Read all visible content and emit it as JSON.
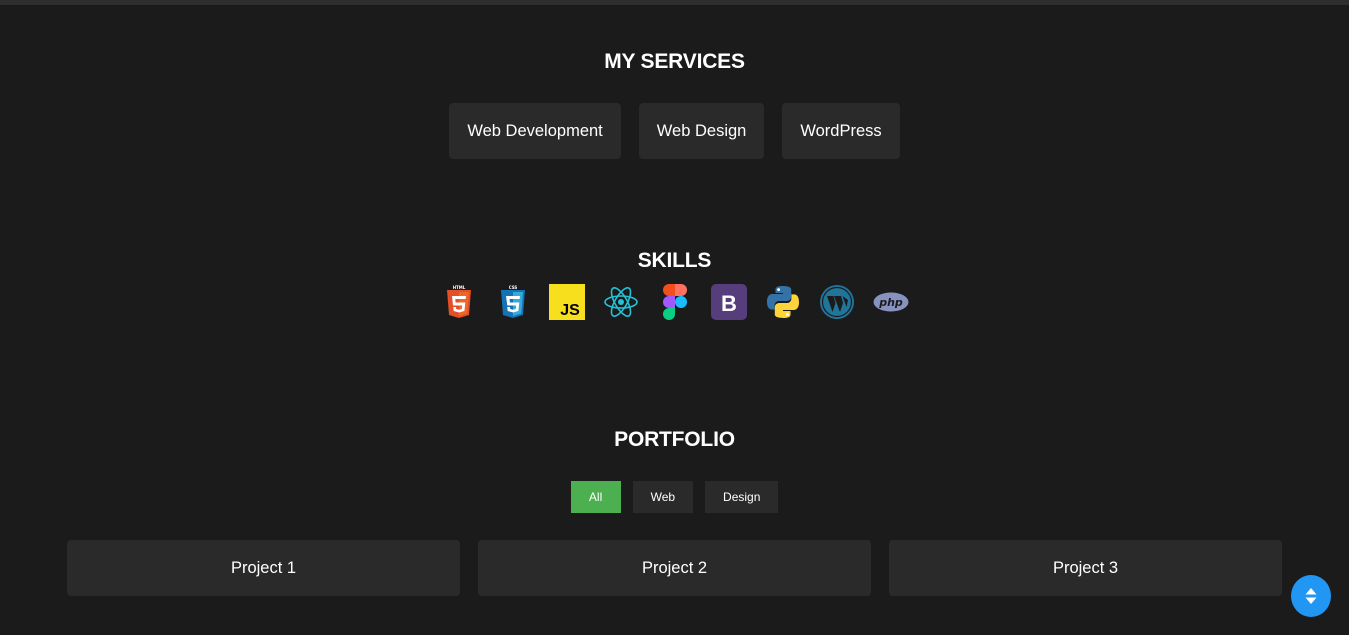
{
  "services": {
    "title": "MY SERVICES",
    "items": [
      {
        "label": "Web Development"
      },
      {
        "label": "Web Design"
      },
      {
        "label": "WordPress"
      }
    ]
  },
  "skills": {
    "title": "SKILLS",
    "icons": [
      "html5-icon",
      "css3-icon",
      "javascript-icon",
      "react-icon",
      "figma-icon",
      "bootstrap-icon",
      "python-icon",
      "wordpress-icon",
      "php-icon"
    ],
    "html_badge": "HTML",
    "css_badge": "CSS",
    "js_text": "JS",
    "bootstrap_letter": "B",
    "php_text": "php"
  },
  "portfolio": {
    "title": "PORTFOLIO",
    "filters": [
      {
        "label": "All",
        "active": true
      },
      {
        "label": "Web",
        "active": false
      },
      {
        "label": "Design",
        "active": false
      }
    ],
    "projects": [
      {
        "label": "Project 1"
      },
      {
        "label": "Project 2"
      },
      {
        "label": "Project 3"
      }
    ]
  },
  "colors": {
    "background": "#1b1b1b",
    "card": "#2a2a2a",
    "active_filter": "#4caf50",
    "scroll_button": "#2196f3"
  },
  "scroll_button_icon": "sort-arrows-icon"
}
